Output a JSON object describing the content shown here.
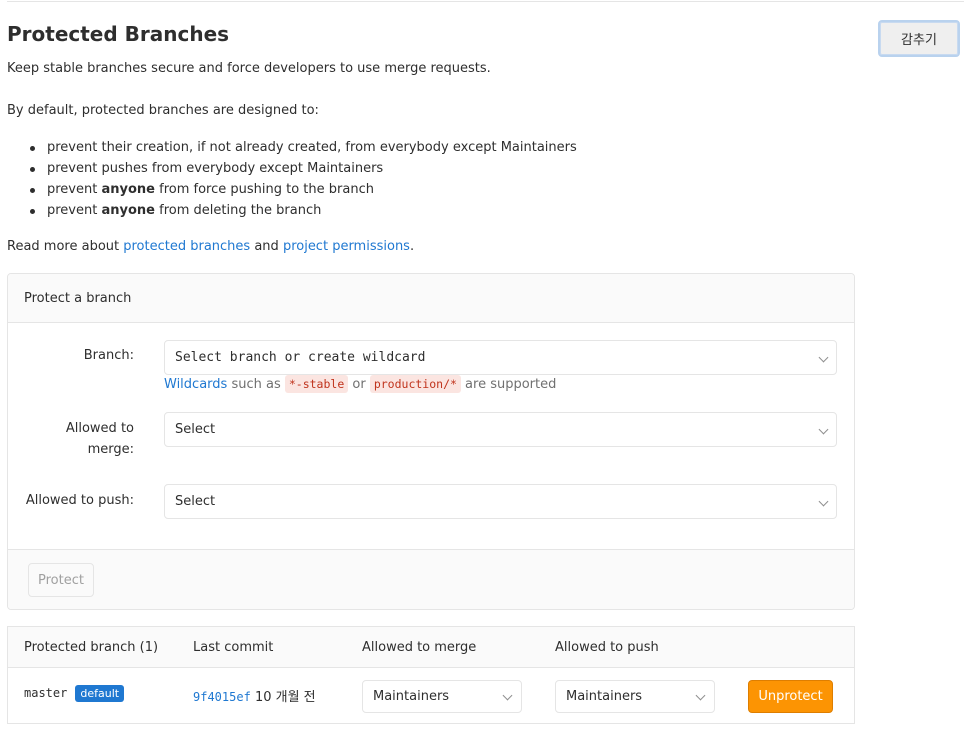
{
  "header": {
    "title": "Protected Branches",
    "collapse_label": "감추기",
    "lead": "Keep stable branches secure and force developers to use merge requests.",
    "by_default": "By default, protected branches are designed to:"
  },
  "rules": [
    {
      "before": "prevent their creation, if not already created, from everybody except Maintainers",
      "bold": "",
      "after": ""
    },
    {
      "before": "prevent pushes from everybody except Maintainers",
      "bold": "",
      "after": ""
    },
    {
      "before": "prevent ",
      "bold": "anyone",
      "after": " from force pushing to the branch"
    },
    {
      "before": "prevent ",
      "bold": "anyone",
      "after": " from deleting the branch"
    }
  ],
  "readmore": {
    "prefix": "Read more about ",
    "link1": "protected branches",
    "middle": " and ",
    "link2": "project permissions",
    "suffix": "."
  },
  "protect_form": {
    "title": "Protect a branch",
    "branch_label": "Branch:",
    "branch_value": "Select branch or create wildcard",
    "hint_link": "Wildcards",
    "hint_text1": " such as ",
    "hint_code1": "*-stable",
    "hint_text2": " or ",
    "hint_code2": "production/*",
    "hint_text3": " are supported",
    "merge_label_line1": "Allowed to",
    "merge_label_line2": "merge:",
    "merge_value": "Select",
    "push_label": "Allowed to push:",
    "push_value": "Select",
    "protect_button": "Protect"
  },
  "table": {
    "headers": [
      "Protected branch (1)",
      "Last commit",
      "Allowed to merge",
      "Allowed to push"
    ],
    "rows": [
      {
        "branch": "master",
        "badge": "default",
        "commit_sha": "9f4015ef",
        "commit_time": "10 개월 전",
        "merge": "Maintainers",
        "push": "Maintainers",
        "action": "Unprotect"
      }
    ]
  }
}
